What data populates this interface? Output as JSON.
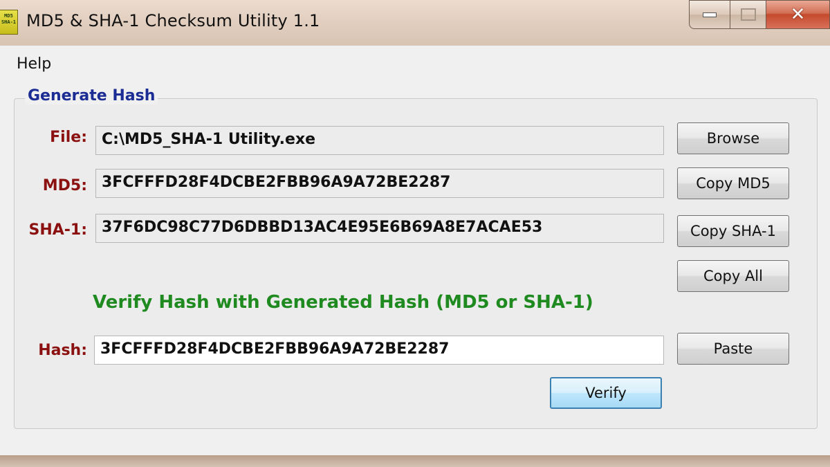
{
  "window": {
    "title": "MD5 & SHA-1 Checksum Utility 1.1",
    "icon_label": "MD5 SHA-1",
    "caption_buttons": {
      "minimize": "minimize-icon",
      "maximize": "maximize-icon",
      "close": "close-icon",
      "close_glyph": "✕"
    }
  },
  "menu": {
    "items": [
      {
        "label": "Help"
      }
    ]
  },
  "generate": {
    "group_title": "Generate Hash",
    "file": {
      "label": "File:",
      "value": "C:\\MD5_SHA-1 Utility.exe"
    },
    "md5": {
      "label": "MD5:",
      "value": "3FCFFFD28F4DCBE2FBB96A9A72BE2287"
    },
    "sha1": {
      "label": "SHA-1:",
      "value": "37F6DC98C77D6DBBD13AC4E95E6B69A8E7ACAE53"
    },
    "buttons": {
      "browse": "Browse",
      "copy_md5": "Copy MD5",
      "copy_sha1": "Copy SHA-1",
      "copy_all": "Copy All"
    }
  },
  "verify": {
    "caption": "Verify Hash with Generated Hash (MD5 or SHA-1)",
    "hash": {
      "label": "Hash:",
      "value": "3FCFFFD28F4DCBE2FBB96A9A72BE2287"
    },
    "buttons": {
      "paste": "Paste",
      "verify": "Verify"
    }
  },
  "colors": {
    "label_red": "#8b1010",
    "group_title_blue": "#1b2d94",
    "verify_green": "#1f8a1f",
    "title_bar": "#e2cfc0"
  }
}
